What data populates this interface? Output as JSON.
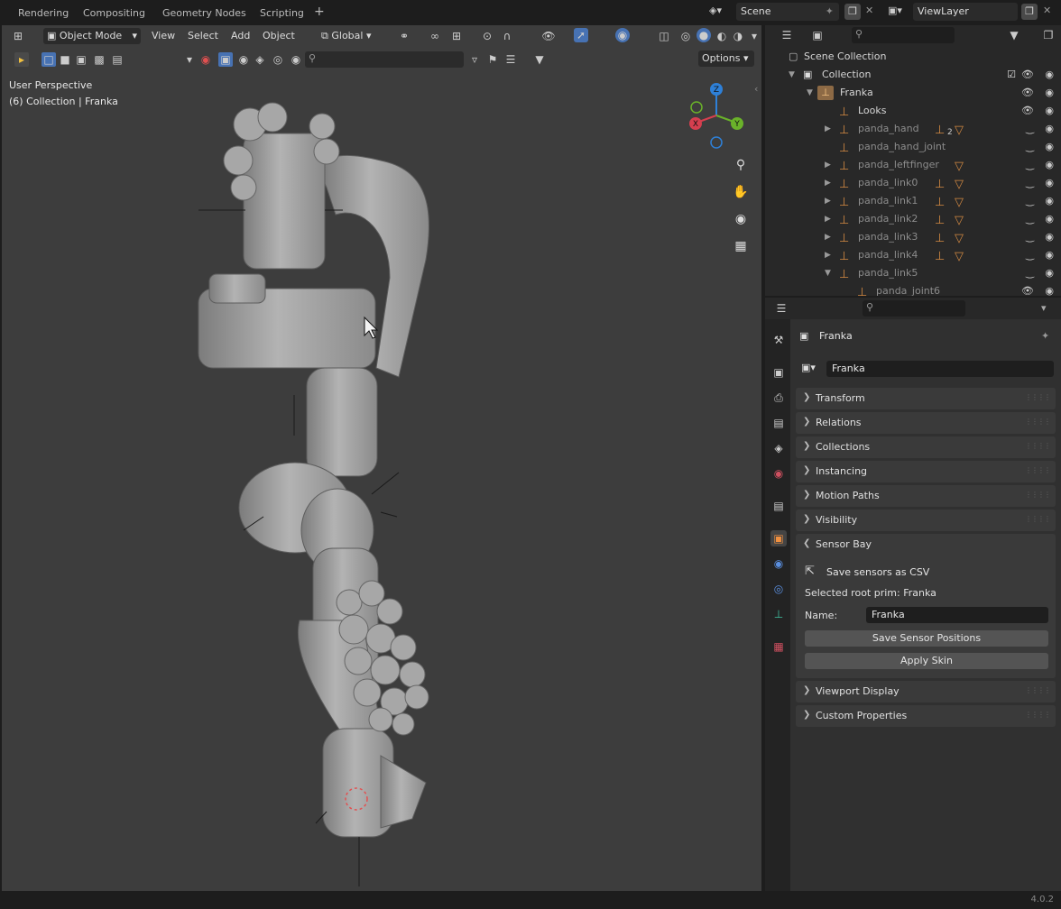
{
  "workspace_tabs": [
    "Rendering",
    "Compositing",
    "Geometry Nodes",
    "Scripting"
  ],
  "scene": {
    "label": "Scene",
    "view_layer": "ViewLayer"
  },
  "viewport": {
    "mode": "Object Mode",
    "menus": [
      "View",
      "Select",
      "Add",
      "Object"
    ],
    "orientation": "Global",
    "options_label": "Options",
    "perspective_label": "User Perspective",
    "collection_label": "(6) Collection | Franka",
    "gizmo": {
      "x": "X",
      "y": "Y",
      "z": "Z"
    }
  },
  "outliner": {
    "rows": [
      {
        "label": "Scene Collection",
        "indent": 0,
        "kind": "scene"
      },
      {
        "label": "Collection",
        "indent": 1,
        "kind": "collection"
      },
      {
        "label": "Franka",
        "indent": 2,
        "kind": "armature"
      },
      {
        "label": "Looks",
        "indent": 3,
        "kind": "bone"
      },
      {
        "label": "panda_hand",
        "indent": 3,
        "kind": "bone",
        "badge": "2"
      },
      {
        "label": "panda_hand_joint",
        "indent": 3,
        "kind": "bone"
      },
      {
        "label": "panda_leftfinger",
        "indent": 3,
        "kind": "bone"
      },
      {
        "label": "panda_link0",
        "indent": 3,
        "kind": "bone"
      },
      {
        "label": "panda_link1",
        "indent": 3,
        "kind": "bone"
      },
      {
        "label": "panda_link2",
        "indent": 3,
        "kind": "bone"
      },
      {
        "label": "panda_link3",
        "indent": 3,
        "kind": "bone"
      },
      {
        "label": "panda_link4",
        "indent": 3,
        "kind": "bone"
      },
      {
        "label": "panda_link5",
        "indent": 3,
        "kind": "bone"
      },
      {
        "label": "panda_joint6",
        "indent": 4,
        "kind": "bone"
      }
    ]
  },
  "properties": {
    "object_name": "Franka",
    "object_field": "Franka",
    "panels": [
      "Transform",
      "Relations",
      "Collections",
      "Instancing",
      "Motion Paths",
      "Visibility",
      "Sensor Bay",
      "Viewport Display",
      "Custom Properties"
    ],
    "sensor_bay": {
      "save_csv_label": "Save sensors as CSV",
      "selected_root": "Selected root prim: Franka",
      "name_label": "Name:",
      "name_value": "Franka",
      "save_positions_label": "Save Sensor Positions",
      "apply_skin_label": "Apply Skin"
    }
  },
  "status": {
    "version": "4.0.2"
  },
  "colors": {
    "accent": "#4772b3",
    "bone": "#d48a42",
    "gizmo_x": "#d53f4f",
    "gizmo_y": "#6ab22a",
    "gizmo_z": "#2e80d8"
  }
}
